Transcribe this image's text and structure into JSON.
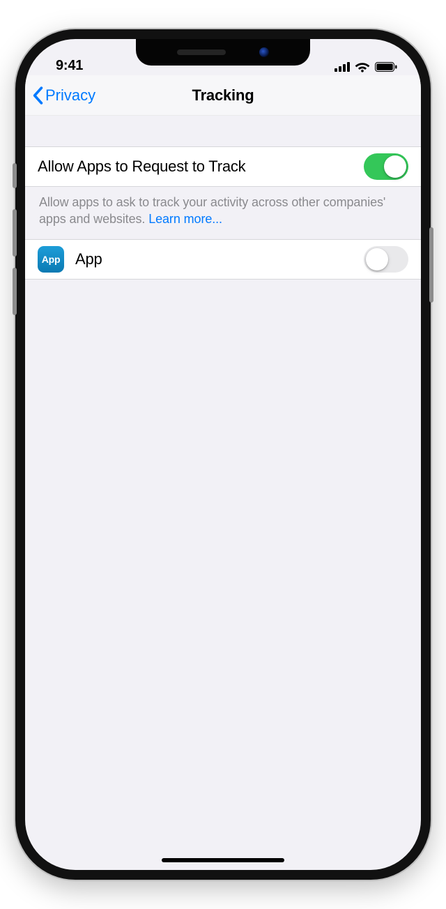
{
  "status": {
    "time": "9:41"
  },
  "nav": {
    "back_label": "Privacy",
    "title": "Tracking"
  },
  "main": {
    "allow_label": "Allow Apps to Request to Track",
    "allow_on": true,
    "footer_text": "Allow apps to ask to track your activity across other companies' apps and websites. ",
    "learn_more": "Learn more..."
  },
  "apps": [
    {
      "icon_text": "App",
      "name": "App",
      "on": false
    }
  ],
  "colors": {
    "tint": "#007aff",
    "switch_on": "#34c759"
  }
}
